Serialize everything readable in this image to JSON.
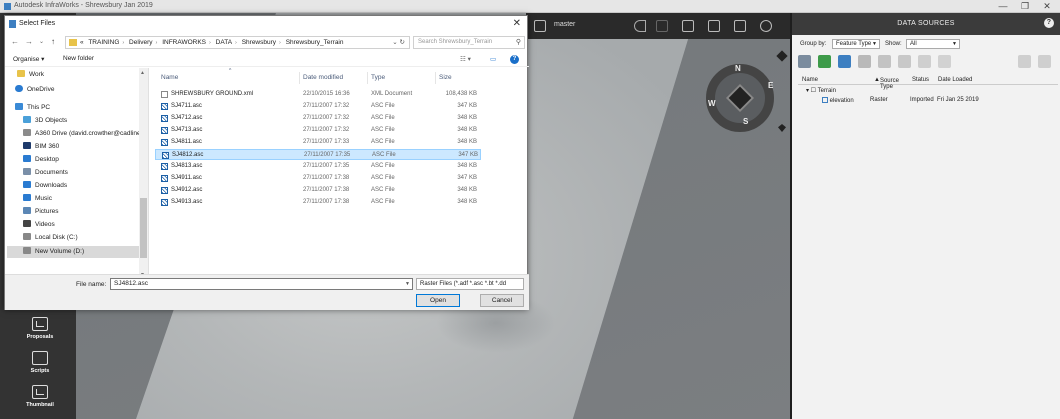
{
  "app": {
    "title": "Autodesk InfraWorks - Shrewsbury Jan 2019",
    "window_controls": [
      "—",
      "❐",
      "✕"
    ]
  },
  "left_tools": [
    {
      "label": "Proposals",
      "icon": "proposals-icon"
    },
    {
      "label": "Scripts",
      "icon": "scripts-icon"
    },
    {
      "label": "Thumbnail",
      "icon": "thumbnail-icon"
    }
  ],
  "viewport": {
    "proposal_label": "master",
    "compass": {
      "n": "N",
      "e": "E",
      "s": "S",
      "w": "W"
    }
  },
  "data_sources": {
    "title": "DATA SOURCES",
    "group_by_label": "Group by:",
    "group_by_value": "Feature Type",
    "show_label": "Show:",
    "show_value": "All",
    "columns": [
      "Name",
      "Source Type",
      "Status",
      "Date Loaded"
    ],
    "group": "Terrain",
    "rows": [
      {
        "name": "elevation",
        "source_type": "Raster",
        "status": "Imported",
        "date_loaded": "Fri Jan 25 2019"
      }
    ]
  },
  "dialog": {
    "title": "Select Files",
    "address": {
      "prefix": "«",
      "crumbs": [
        "TRAINING",
        "Delivery",
        "INFRAWORKS",
        "DATA",
        "Shrewsbury",
        "Shrewsbury_Terrain"
      ]
    },
    "search_placeholder": "Search Shrewsbury_Terrain",
    "organise_label": "Organise ▾",
    "new_folder_label": "New folder",
    "nav_items": [
      {
        "label": "Work",
        "icon": "folder-icon",
        "color": "#e8c34a"
      },
      {
        "label": "OneDrive",
        "icon": "cloud-icon",
        "color": "#2a7bd1"
      },
      {
        "label": "This PC",
        "icon": "pc-icon",
        "color": "#3a8ad6"
      },
      {
        "label": "3D Objects",
        "icon": "3d-objects-icon",
        "color": "#4aa0d9"
      },
      {
        "label": "A360 Drive (david.crowther@cadline",
        "icon": "a360-icon",
        "color": "#8b8b8b"
      },
      {
        "label": "BIM 360",
        "icon": "bim360-icon",
        "color": "#1e3a6b"
      },
      {
        "label": "Desktop",
        "icon": "desktop-icon",
        "color": "#2a7bd1"
      },
      {
        "label": "Documents",
        "icon": "documents-icon",
        "color": "#7a8fa8"
      },
      {
        "label": "Downloads",
        "icon": "downloads-icon",
        "color": "#2a7bd1"
      },
      {
        "label": "Music",
        "icon": "music-icon",
        "color": "#2a7bd1"
      },
      {
        "label": "Pictures",
        "icon": "pictures-icon",
        "color": "#5b87b5"
      },
      {
        "label": "Videos",
        "icon": "videos-icon",
        "color": "#444"
      },
      {
        "label": "Local Disk (C:)",
        "icon": "disk-icon",
        "color": "#888"
      },
      {
        "label": "New Volume (D:)",
        "icon": "disk-icon",
        "color": "#888"
      }
    ],
    "columns": {
      "name": "Name",
      "date": "Date modified",
      "type": "Type",
      "size": "Size"
    },
    "files": [
      {
        "name": "SHREWSBURY GROUND.xml",
        "date": "22/10/2015 16:36",
        "type": "XML Document",
        "size": "108,438 KB"
      },
      {
        "name": "SJ4711.asc",
        "date": "27/11/2007 17:32",
        "type": "ASC File",
        "size": "347 KB"
      },
      {
        "name": "SJ4712.asc",
        "date": "27/11/2007 17:32",
        "type": "ASC File",
        "size": "348 KB"
      },
      {
        "name": "SJ4713.asc",
        "date": "27/11/2007 17:32",
        "type": "ASC File",
        "size": "348 KB"
      },
      {
        "name": "SJ4811.asc",
        "date": "27/11/2007 17:33",
        "type": "ASC File",
        "size": "348 KB"
      },
      {
        "name": "SJ4812.asc",
        "date": "27/11/2007 17:35",
        "type": "ASC File",
        "size": "347 KB"
      },
      {
        "name": "SJ4813.asc",
        "date": "27/11/2007 17:35",
        "type": "ASC File",
        "size": "348 KB"
      },
      {
        "name": "SJ4911.asc",
        "date": "27/11/2007 17:38",
        "type": "ASC File",
        "size": "347 KB"
      },
      {
        "name": "SJ4912.asc",
        "date": "27/11/2007 17:38",
        "type": "ASC File",
        "size": "348 KB"
      },
      {
        "name": "SJ4913.asc",
        "date": "27/11/2007 17:38",
        "type": "ASC File",
        "size": "348 KB"
      }
    ],
    "selected_index": 5,
    "file_name_label": "File name:",
    "file_name_value": "SJ4812.asc",
    "filter_value": "Raster Files (*.adf *.asc *.bt *.dd",
    "open_label": "Open",
    "cancel_label": "Cancel"
  }
}
